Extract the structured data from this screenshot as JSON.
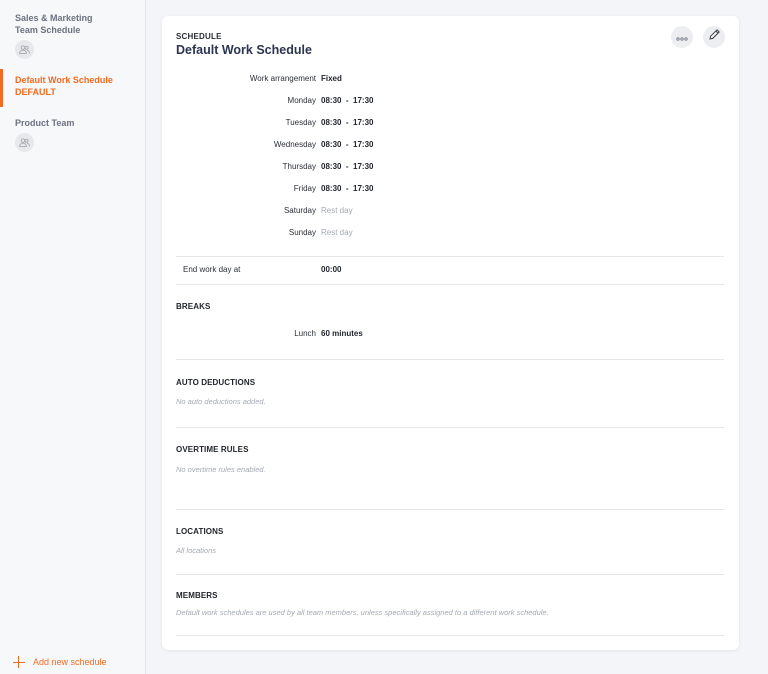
{
  "sidebar": {
    "items": [
      {
        "name": "Sales & Marketing Team Schedule",
        "sub": ""
      },
      {
        "name": "Default Work Schedule",
        "sub": "DEFAULT"
      },
      {
        "name": "Product Team",
        "sub": ""
      }
    ],
    "add_new_label": "Add new schedule"
  },
  "schedule": {
    "kicker": "SCHEDULE",
    "title": "Default Work Schedule",
    "work_arrangement_label": "Work arrangement",
    "work_arrangement_value": "Fixed",
    "days": [
      {
        "day": "Monday",
        "hours": "08:30  -  17:30"
      },
      {
        "day": "Tuesday",
        "hours": "08:30  -  17:30"
      },
      {
        "day": "Wednesday",
        "hours": "08:30  -  17:30"
      },
      {
        "day": "Thursday",
        "hours": "08:30  -  17:30"
      },
      {
        "day": "Friday",
        "hours": "08:30  -  17:30"
      },
      {
        "day": "Saturday",
        "hours": "Rest day"
      },
      {
        "day": "Sunday",
        "hours": "Rest day"
      }
    ],
    "end_work_day_label": "End work day at",
    "end_work_day_value": "00:00"
  },
  "breaks": {
    "heading": "BREAKS",
    "items": [
      {
        "name": "Lunch",
        "duration": "60 minutes"
      }
    ]
  },
  "auto_deductions": {
    "heading": "AUTO DEDUCTIONS",
    "note": "No auto deductions added."
  },
  "overtime": {
    "heading": "OVERTIME RULES",
    "note": "No overtime rules enabled."
  },
  "locations": {
    "heading": "LOCATIONS",
    "note": "All locations"
  },
  "members": {
    "heading": "MEMBERS",
    "note": "Default work schedules are used by all team members, unless specifically assigned to a different work schedule."
  },
  "colors": {
    "accent": "#f26b21",
    "muted": "#a4a9b1"
  },
  "icons": {
    "more": "more-dots-icon",
    "edit": "pencil-icon",
    "avatar": "users-icon",
    "add": "plus-icon"
  }
}
